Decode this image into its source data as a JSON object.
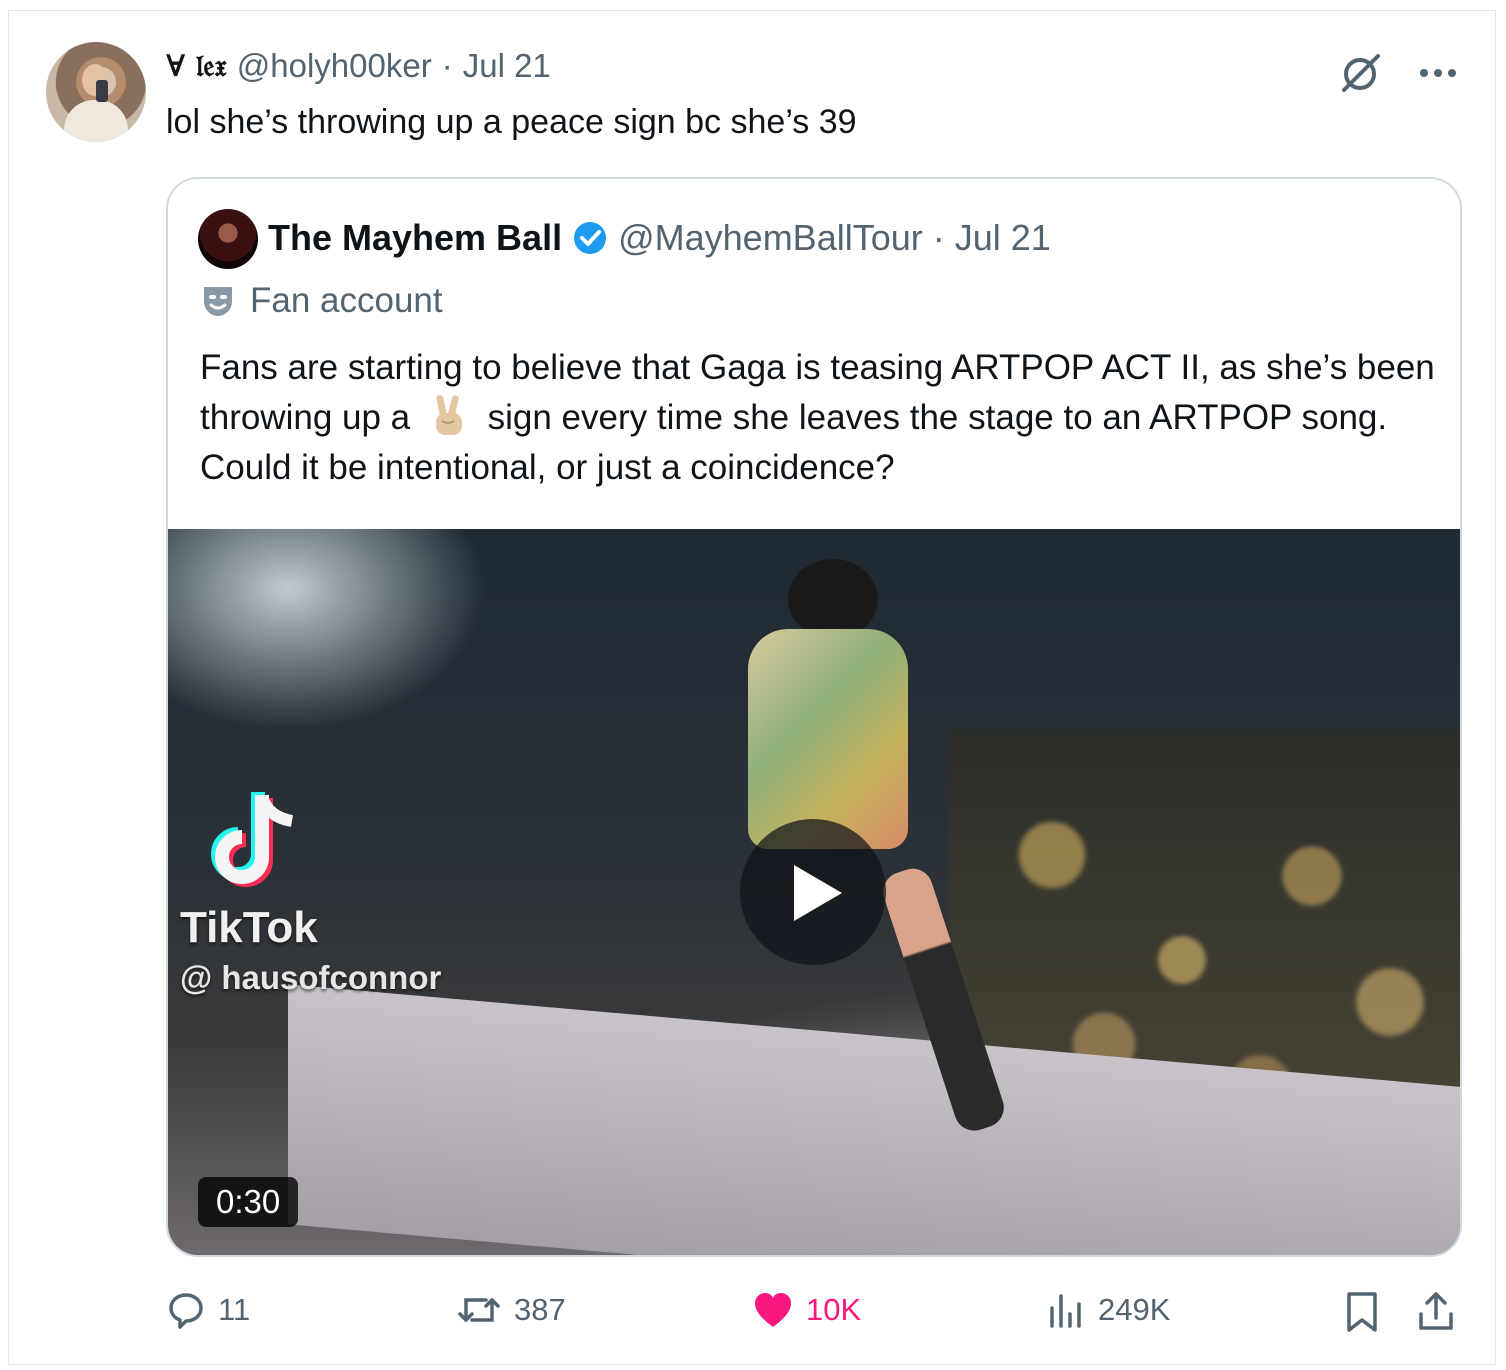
{
  "tweet": {
    "display_name": "∀ 𝔩𝔢𝔵",
    "handle": "@holyh00ker",
    "separator": "·",
    "date": "Jul 21",
    "text": "lol she’s throwing up a peace sign bc she’s 39"
  },
  "quote": {
    "name": "The Mayhem Ball",
    "handle": "@MayhemBallTour",
    "separator": "·",
    "date": "Jul 21",
    "label": "Fan account",
    "text_part1": "Fans are starting to believe that Gaga is teasing ARTPOP ACT II, as she’s been throwing up a",
    "text_part2": "sign every time she leaves the stage to an ARTPOP song. Could it be intentional, or just a coincidence?",
    "video": {
      "tiktok_label": "TikTok",
      "tiktok_handle": "@ hausofconnor",
      "duration": "0:30"
    }
  },
  "actions": {
    "replies": "11",
    "reposts": "387",
    "likes": "10K",
    "views": "249K"
  },
  "colors": {
    "like": "#f91880",
    "verified": "#1d9bf0",
    "muted_text": "#536471"
  },
  "icons": [
    "grok-icon",
    "more-icon",
    "verified-icon",
    "fan-account-icon",
    "peace-emoji",
    "tiktok-icon",
    "play-icon",
    "reply-icon",
    "repost-icon",
    "like-icon",
    "views-icon",
    "bookmark-icon",
    "share-icon"
  ]
}
